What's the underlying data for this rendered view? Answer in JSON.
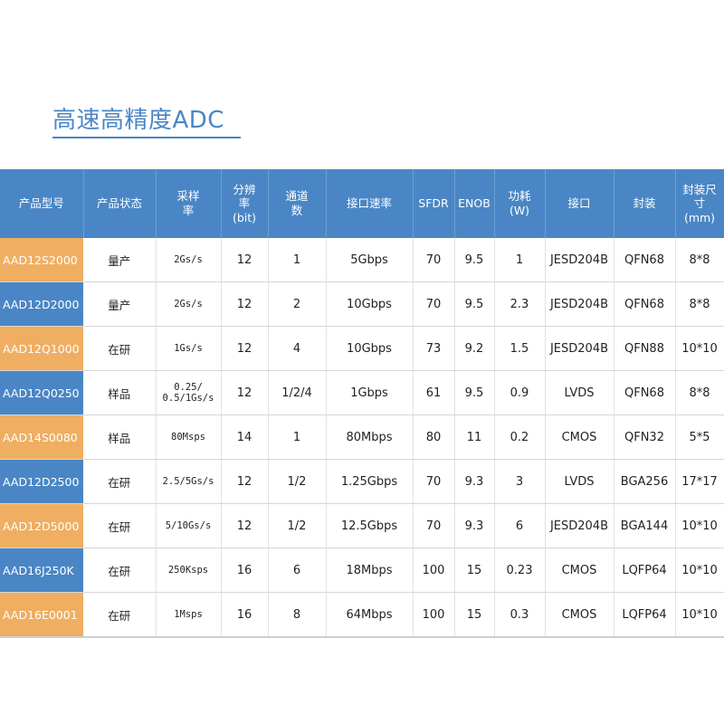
{
  "page": {
    "title": "高速高精度ADC"
  },
  "table": {
    "headers": [
      "产品型号",
      "产品状态",
      "采样\n率",
      "分辨\n率\n(bit)",
      "通道\n数",
      "接口速率",
      "SFDR",
      "ENOB",
      "功耗\n(W)",
      "接口",
      "封装",
      "封装尺寸\n(mm)"
    ],
    "row_colors": [
      "#efae62",
      "#4a86c5"
    ],
    "header_color": "#4a86c5",
    "rows": [
      [
        "AAD12S2000",
        "量产",
        "2Gs/s",
        "12",
        "1",
        "5Gbps",
        "70",
        "9.5",
        "1",
        "JESD204B",
        "QFN68",
        "8*8"
      ],
      [
        "AAD12D2000",
        "量产",
        "2Gs/s",
        "12",
        "2",
        "10Gbps",
        "70",
        "9.5",
        "2.3",
        "JESD204B",
        "QFN68",
        "8*8"
      ],
      [
        "AAD12Q1000",
        "在研",
        "1Gs/s",
        "12",
        "4",
        "10Gbps",
        "73",
        "9.2",
        "1.5",
        "JESD204B",
        "QFN88",
        "10*10"
      ],
      [
        "AAD12Q0250",
        "样品",
        "0.25/\n0.5/1Gs/s",
        "12",
        "1/2/4",
        "1Gbps",
        "61",
        "9.5",
        "0.9",
        "LVDS",
        "QFN68",
        "8*8"
      ],
      [
        "AAD14S0080",
        "样品",
        "80Msps",
        "14",
        "1",
        "80Mbps",
        "80",
        "11",
        "0.2",
        "CMOS",
        "QFN32",
        "5*5"
      ],
      [
        "AAD12D2500",
        "在研",
        "2.5/5Gs/s",
        "12",
        "1/2",
        "1.25Gbps",
        "70",
        "9.3",
        "3",
        "LVDS",
        "BGA256",
        "17*17"
      ],
      [
        "AAD12D5000",
        "在研",
        "5/10Gs/s",
        "12",
        "1/2",
        "12.5Gbps",
        "70",
        "9.3",
        "6",
        "JESD204B",
        "BGA144",
        "10*10"
      ],
      [
        "AAD16J250K",
        "在研",
        "250Ksps",
        "16",
        "6",
        "18Mbps",
        "100",
        "15",
        "0.23",
        "CMOS",
        "LQFP64",
        "10*10"
      ],
      [
        "AAD16E0001",
        "在研",
        "1Msps",
        "16",
        "8",
        "64Mbps",
        "100",
        "15",
        "0.3",
        "CMOS",
        "LQFP64",
        "10*10"
      ]
    ]
  }
}
